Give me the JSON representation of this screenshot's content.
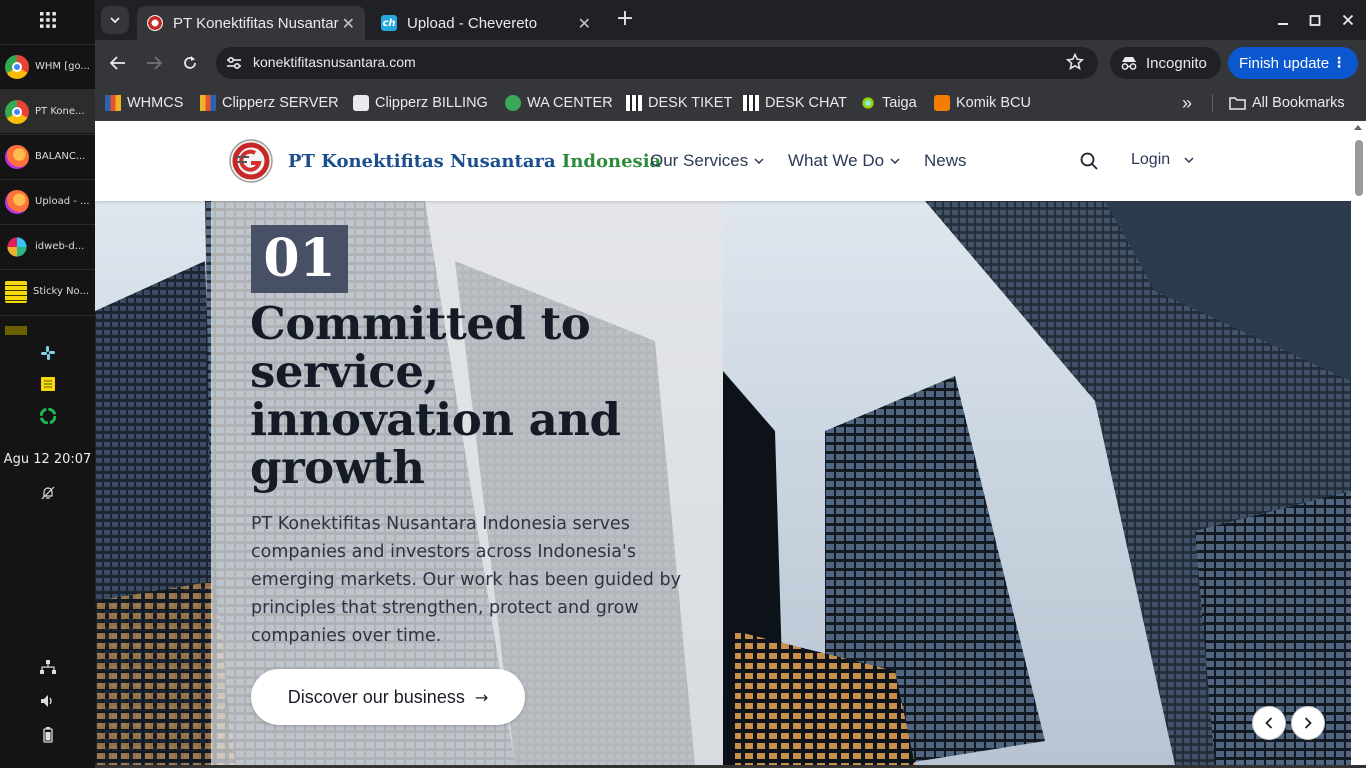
{
  "dock": {
    "tasks": [
      {
        "label": "WHM [go...",
        "icon": "chrome-icon",
        "color": "#4285f4"
      },
      {
        "label": "PT Kone...",
        "icon": "chrome-icon",
        "color": "#4285f4",
        "active": true
      },
      {
        "label": "BALANC...",
        "icon": "firefox-icon",
        "color": "#ff7139"
      },
      {
        "label": "Upload - ...",
        "icon": "firefox-icon",
        "color": "#ff7139"
      },
      {
        "label": "idweb-d...",
        "icon": "slack-icon",
        "color": "#4a154b"
      },
      {
        "label": "Sticky No...",
        "icon": "sticky-notes-icon",
        "color": "#f5d90a"
      }
    ],
    "clock": "Agu 12  20:07"
  },
  "browser": {
    "tabs": [
      {
        "title": "PT Konektifitas Nusantara Indonesia",
        "active": true
      },
      {
        "title": "Upload - Chevereto",
        "favicon_text": "ch",
        "active": false
      }
    ],
    "url": "konektifitasnusantara.com",
    "incognito_label": "Incognito",
    "update_label": "Finish update",
    "bookmarks": [
      {
        "label": "WHMCS"
      },
      {
        "label": "Clipperz SERVER"
      },
      {
        "label": "Clipperz BILLING"
      },
      {
        "label": "WA CENTER"
      },
      {
        "label": "DESK TIKET"
      },
      {
        "label": "DESK CHAT"
      },
      {
        "label": "Taiga"
      },
      {
        "label": "Komik BCU"
      }
    ],
    "overflow_label": "»",
    "all_bookmarks_label": "All Bookmarks"
  },
  "site": {
    "brand_part1": "PT Konektifitas Nusantara",
    "brand_part2": "Indonesia",
    "nav": [
      {
        "label": "Our Services",
        "dropdown": true
      },
      {
        "label": "What We Do",
        "dropdown": true
      },
      {
        "label": "News",
        "dropdown": false
      }
    ],
    "login_label": "Login",
    "colors": {
      "brand_blue": "#1b4f8c",
      "brand_green": "#2e8b3e",
      "slide_num_bg": "#475064"
    }
  },
  "hero": {
    "slide_number": "01",
    "headline": "Committed to service, innovation and growth",
    "blurb": "PT Konektifitas Nusantara Indonesia serves companies and investors across Indonesia's emerging markets. Our work has been guided by principles that strengthen, protect and grow companies over time.",
    "cta_label": "Discover our business",
    "cta_arrow": "→"
  }
}
